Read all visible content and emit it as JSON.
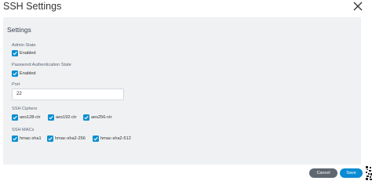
{
  "dialog": {
    "title": "SSH Settings",
    "close_icon": "close-icon"
  },
  "panel": {
    "title": "Settings",
    "admin_state": {
      "label": "Admin State",
      "option": "Enabled",
      "checked": true
    },
    "password_auth_state": {
      "label": "Password Authentication State",
      "option": "Enabled",
      "checked": true
    },
    "port": {
      "label": "Port",
      "value": "22"
    },
    "ciphers": {
      "label": "SSH Ciphers",
      "items": [
        {
          "label": "aes128-ctr",
          "checked": true
        },
        {
          "label": "aes192-ctr",
          "checked": true
        },
        {
          "label": "aes256-ctr",
          "checked": true
        }
      ]
    },
    "macs": {
      "label": "SSH MACs",
      "items": [
        {
          "label": "hmac-sha1",
          "checked": true
        },
        {
          "label": "hmac-sha2-256",
          "checked": true
        },
        {
          "label": "hmac-sha2-512",
          "checked": true
        }
      ]
    }
  },
  "footer": {
    "cancel_label": "Cancel",
    "save_label": "Save"
  },
  "colors": {
    "accent": "#0a8bd3",
    "cancel": "#5e6770",
    "panel_bg": "#f0f1f3"
  }
}
